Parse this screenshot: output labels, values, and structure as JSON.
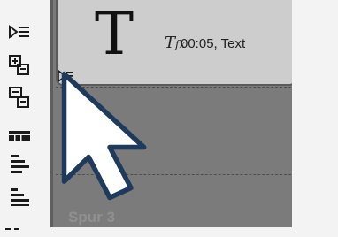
{
  "toolbar": {
    "buttons": [
      {
        "name": "indent-track-button",
        "icon": "indent-icon"
      },
      {
        "name": "add-track-above-button",
        "icon": "track-add-icon"
      },
      {
        "name": "add-track-below-button",
        "icon": "track-add-below-icon"
      },
      {
        "name": "tracks-view-button",
        "icon": "tracks-icon"
      },
      {
        "name": "align-left-button",
        "icon": "align-left-icon"
      },
      {
        "name": "align-lines-button",
        "icon": "align-lines-icon"
      }
    ]
  },
  "clip": {
    "glyph": "T",
    "fx_glyph": "T",
    "meta": "00:05, Text"
  },
  "tracks": {
    "track_label_partial": "Spur 3"
  },
  "colors": {
    "timeline_bg": "#7b7b7b",
    "clip_bg": "#cdcdcd",
    "toolbar_bg": "#f3f3f3",
    "toolbar_icon": "#1a1a1a"
  }
}
